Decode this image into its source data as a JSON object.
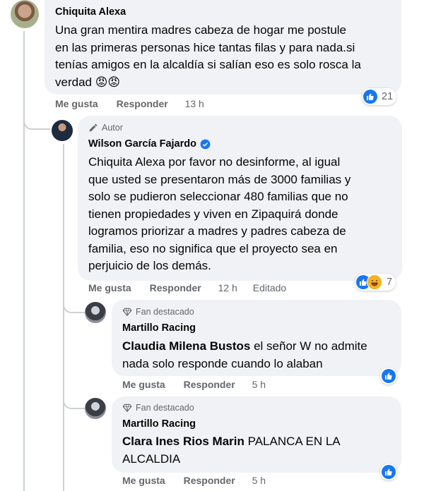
{
  "comments": [
    {
      "name": "Chiquita Alexa",
      "lines": [
        "Una gran mentira madres cabeza de hogar me postule",
        "en las primeras personas hice tantas filas y para nada.si",
        "tenías amigos en la alcaldía si salían eso es solo rosca la",
        "verdad 😡😡"
      ],
      "like_label": "Me gusta",
      "reply_label": "Responder",
      "time": "13 h",
      "reaction_count": "21"
    },
    {
      "badge": "Autor",
      "name": "Wilson García Fajardo",
      "verified": true,
      "lines": [
        "Chiquita Alexa por favor no desinforme, al igual",
        "que usted se presentaron más de 3000 familias y",
        "solo se pudieron seleccionar 480 familias que no",
        "tienen propiedades y viven en Zipaquirá donde",
        "logramos priorizar a madres y padres cabeza de",
        "familia, eso no significa que el proyecto sea en",
        "perjuicio de los demás."
      ],
      "like_label": "Me gusta",
      "reply_label": "Responder",
      "time": "12 h",
      "edited": "Editado",
      "reaction_count": "7"
    },
    {
      "badge": "Fan destacado",
      "name": "Martillo Racing",
      "mention": "Claudia Milena Bustos",
      "lines": [
        " el señor W no admite",
        "nada solo responde cuando lo alaban"
      ],
      "like_label": "Me gusta",
      "reply_label": "Responder",
      "time": "5 h"
    },
    {
      "badge": "Fan destacado",
      "name": "Martillo Racing",
      "mention": "Clara Ines Rios Marin",
      "lines": [
        " PALANCA EN LA",
        "ALCALDIA"
      ],
      "like_label": "Me gusta",
      "reply_label": "Responder",
      "time": "5 h"
    }
  ],
  "colors": {
    "bubble": "#f0f2f5",
    "meta": "#65676b",
    "like": "#1877f2",
    "haha": "#f7b125",
    "thread": "#ccd0d5"
  },
  "icons": {
    "author_badge": "pencil-icon",
    "fan_badge": "diamond-icon",
    "verified": "verified-badge-icon",
    "like": "like-reaction-icon",
    "haha": "haha-reaction-icon"
  }
}
